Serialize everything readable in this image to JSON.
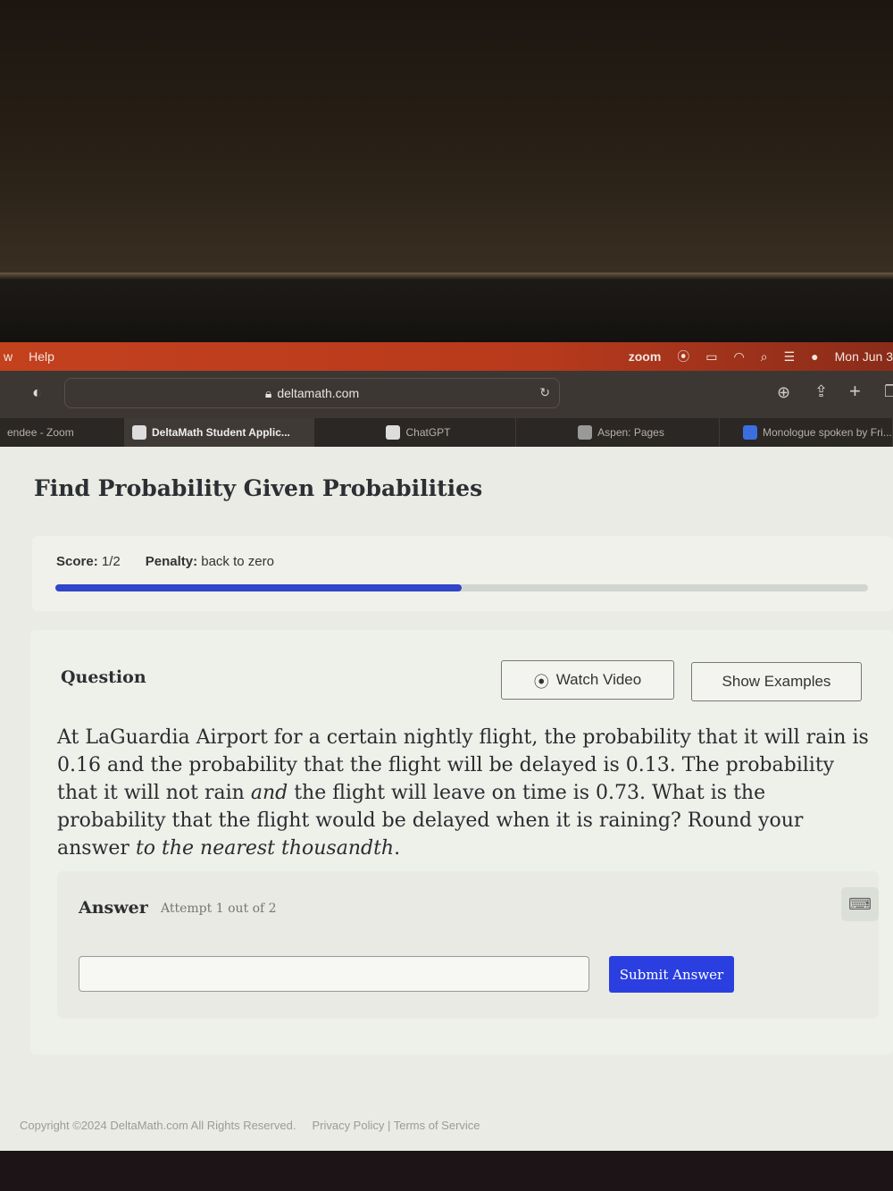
{
  "menubar": {
    "left_items": [
      "w",
      "Help"
    ],
    "zoom_label": "zoom",
    "clock": "Mon Jun 3"
  },
  "browser": {
    "url": "deltamath.com",
    "tabs": [
      {
        "label": "endee - Zoom"
      },
      {
        "label": "DeltaMath Student Applic...",
        "active": true
      },
      {
        "label": "ChatGPT"
      },
      {
        "label": "Aspen: Pages"
      },
      {
        "label": "Monologue spoken by Fri..."
      }
    ]
  },
  "page": {
    "title": "Find Probability Given Probabilities",
    "score_label": "Score:",
    "score_value": "1/2",
    "penalty_label": "Penalty:",
    "penalty_value": "back to zero",
    "progress_percent": 50,
    "question_label": "Question",
    "watch_video": "Watch Video",
    "show_examples": "Show Examples",
    "question_parts": [
      "At LaGuardia Airport for a certain nightly flight, the probability that it will rain is 0.16 and the probability that the flight will be delayed is 0.13. The probability that it will not rain ",
      "and",
      " the flight will leave on time is 0.73. What is the probability that the flight would be delayed when it is raining? Round your answer ",
      "to the nearest thousandth",
      "."
    ],
    "answer_label": "Answer",
    "attempt": "Attempt 1 out of 2",
    "answer_value": "",
    "submit": "Submit Answer",
    "accent": "#2b3fe0"
  },
  "footer": {
    "copyright": "Copyright ©2024 DeltaMath.com All Rights Reserved.",
    "links": "Privacy Policy | Terms of Service"
  }
}
